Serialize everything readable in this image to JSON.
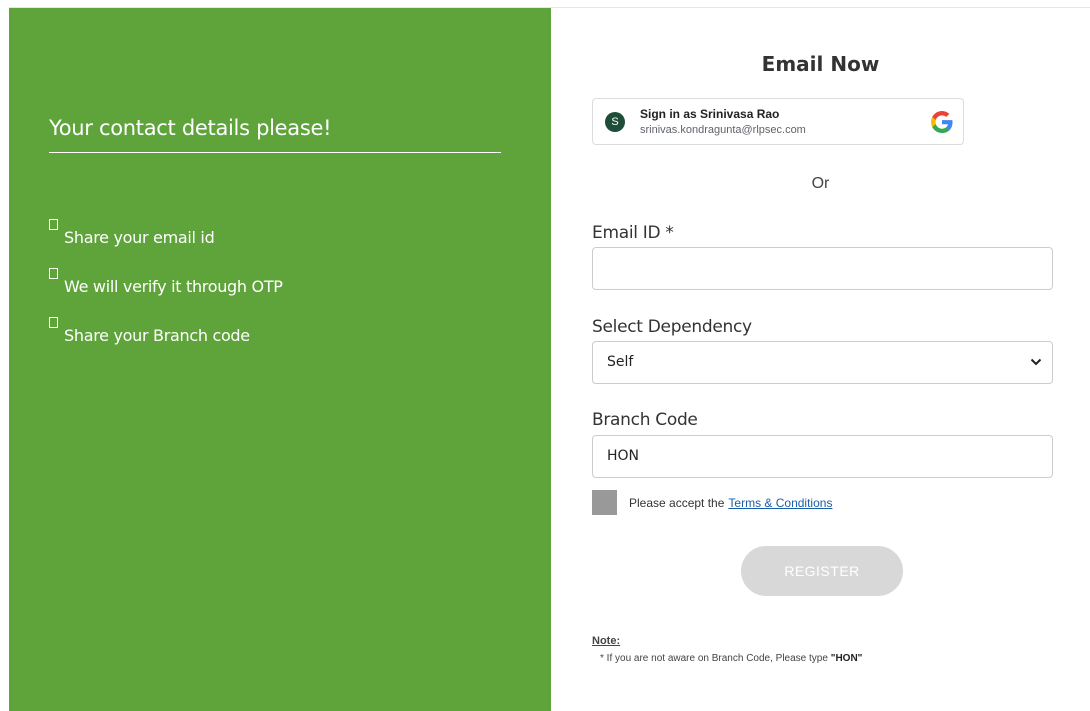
{
  "left_panel": {
    "title": "Your contact details please!",
    "steps": [
      "Share your email id",
      "We will verify it through OTP",
      "Share your Branch code"
    ],
    "background_color": "#5fa43a"
  },
  "form": {
    "title": "Email Now",
    "google_signin": {
      "avatar_letter": "S",
      "name_line": "Sign in as Srinivasa Rao",
      "email_line": "srinivas.kondragunta@rlpsec.com",
      "icon": "google-g-icon"
    },
    "or_text": "Or",
    "email": {
      "label": "Email ID *",
      "value": ""
    },
    "dependency": {
      "label": "Select Dependency",
      "selected": "Self",
      "icon": "chevron-down-icon"
    },
    "branch": {
      "label": "Branch Code",
      "value": "HON"
    },
    "terms": {
      "prefix": "Please accept the",
      "link_text": "Terms & Conditions",
      "checked": false
    },
    "register_label": "REGISTER",
    "note": {
      "heading": "Note:",
      "text_prefix": "* If you are not aware on Branch Code, Please type",
      "text_code": "\"HON\""
    }
  }
}
